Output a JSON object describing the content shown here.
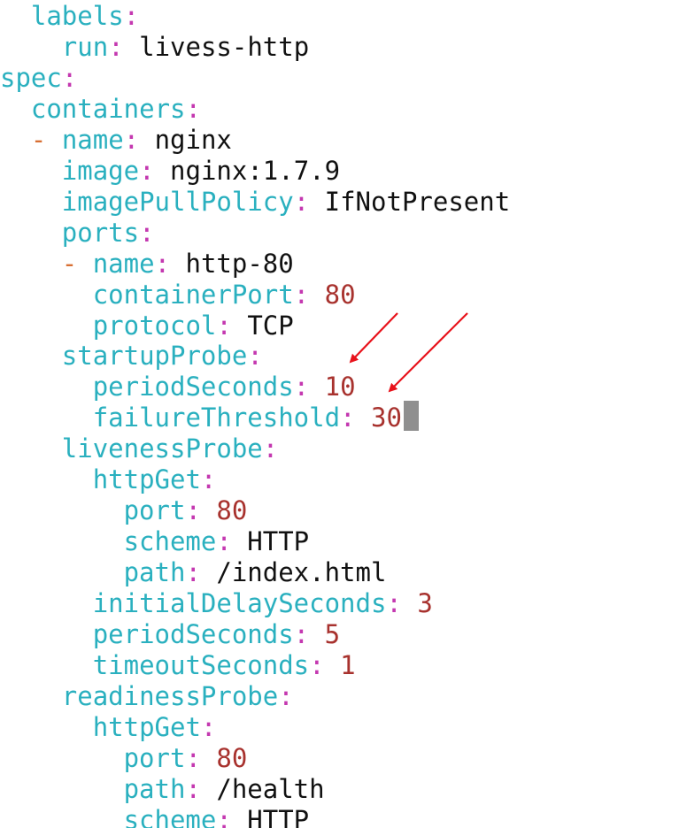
{
  "colors": {
    "key": "#2ab0bf",
    "punctuation": "#c438b0",
    "dash": "#d86f33",
    "string": "#111111",
    "number": "#a8322e",
    "cursor": "#8f8f8f",
    "annotation_arrow": "#e8121b"
  },
  "editor": {
    "lines": [
      {
        "indent": 2,
        "dash": false,
        "key": "labels",
        "value": "",
        "type": "none"
      },
      {
        "indent": 4,
        "dash": false,
        "key": "run",
        "value": "livess-http",
        "type": "string"
      },
      {
        "indent": 0,
        "dash": false,
        "key": "spec",
        "value": "",
        "type": "none"
      },
      {
        "indent": 2,
        "dash": false,
        "key": "containers",
        "value": "",
        "type": "none"
      },
      {
        "indent": 2,
        "dash": true,
        "key": "name",
        "value": "nginx",
        "type": "string"
      },
      {
        "indent": 4,
        "dash": false,
        "key": "image",
        "value": "nginx:1.7.9",
        "type": "string"
      },
      {
        "indent": 4,
        "dash": false,
        "key": "imagePullPolicy",
        "value": "IfNotPresent",
        "type": "string"
      },
      {
        "indent": 4,
        "dash": false,
        "key": "ports",
        "value": "",
        "type": "none"
      },
      {
        "indent": 4,
        "dash": true,
        "key": "name",
        "value": "http-80",
        "type": "string"
      },
      {
        "indent": 6,
        "dash": false,
        "key": "containerPort",
        "value": "80",
        "type": "number"
      },
      {
        "indent": 6,
        "dash": false,
        "key": "protocol",
        "value": "TCP",
        "type": "string"
      },
      {
        "indent": 4,
        "dash": false,
        "key": "startupProbe",
        "value": "",
        "type": "none"
      },
      {
        "indent": 6,
        "dash": false,
        "key": "periodSeconds",
        "value": "10",
        "type": "number"
      },
      {
        "indent": 6,
        "dash": false,
        "key": "failureThreshold",
        "value": "30",
        "type": "number"
      },
      {
        "indent": 4,
        "dash": false,
        "key": "livenessProbe",
        "value": "",
        "type": "none"
      },
      {
        "indent": 6,
        "dash": false,
        "key": "httpGet",
        "value": "",
        "type": "none"
      },
      {
        "indent": 8,
        "dash": false,
        "key": "port",
        "value": "80",
        "type": "number"
      },
      {
        "indent": 8,
        "dash": false,
        "key": "scheme",
        "value": "HTTP",
        "type": "string"
      },
      {
        "indent": 8,
        "dash": false,
        "key": "path",
        "value": "/index.html",
        "type": "string"
      },
      {
        "indent": 6,
        "dash": false,
        "key": "initialDelaySeconds",
        "value": "3",
        "type": "number"
      },
      {
        "indent": 6,
        "dash": false,
        "key": "periodSeconds",
        "value": "5",
        "type": "number"
      },
      {
        "indent": 6,
        "dash": false,
        "key": "timeoutSeconds",
        "value": "1",
        "type": "number"
      },
      {
        "indent": 4,
        "dash": false,
        "key": "readinessProbe",
        "value": "",
        "type": "none"
      },
      {
        "indent": 6,
        "dash": false,
        "key": "httpGet",
        "value": "",
        "type": "none"
      },
      {
        "indent": 8,
        "dash": false,
        "key": "port",
        "value": "80",
        "type": "number"
      },
      {
        "indent": 8,
        "dash": false,
        "key": "path",
        "value": "/health",
        "type": "string"
      },
      {
        "indent": 8,
        "dash": false,
        "key": "scheme",
        "value": "HTTP",
        "type": "string"
      }
    ]
  }
}
